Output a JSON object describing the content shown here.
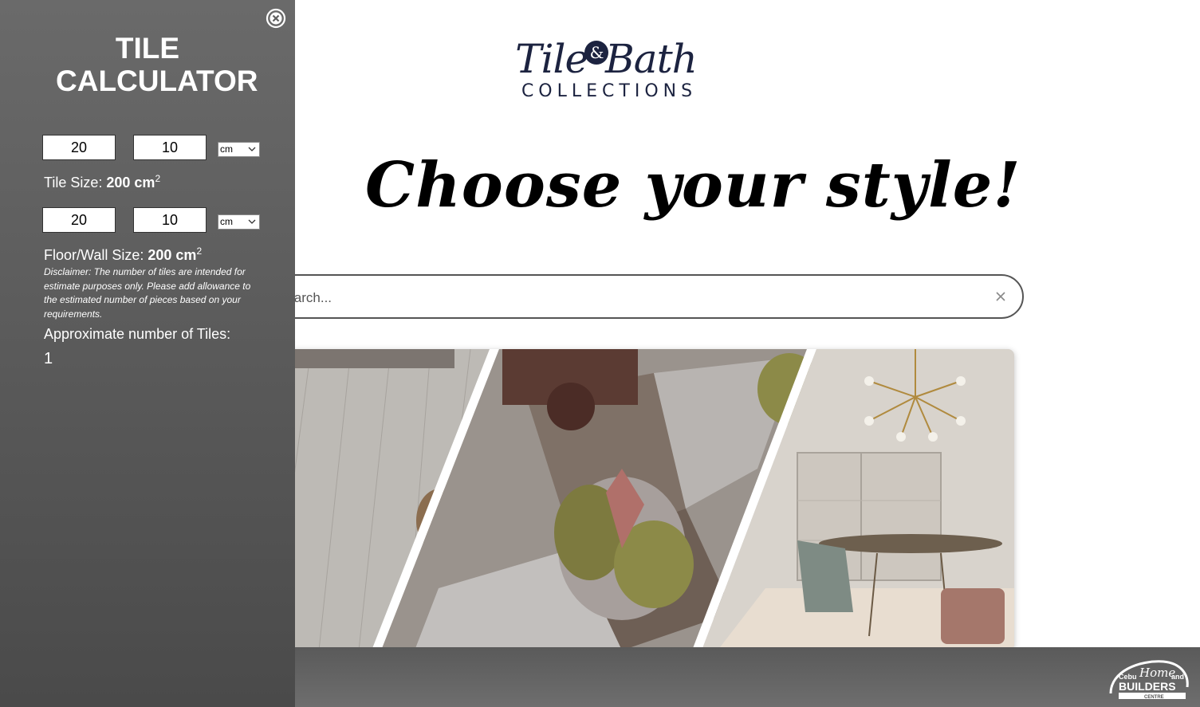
{
  "brand": {
    "logo_script_left": "Tile",
    "logo_amp": "&",
    "logo_script_right": "Bath",
    "logo_sub": "COLLECTIONS"
  },
  "headline": "Choose your style!",
  "search": {
    "placeholder": "Search..."
  },
  "footer": {
    "partner_logo": {
      "line1_left": "Cebu",
      "line1_script": "Home",
      "line1_right": "and",
      "line2": "BUILDERS",
      "line3": "CENTRE"
    }
  },
  "calculator": {
    "title": "TILE CALCULATOR",
    "tile": {
      "width": "20",
      "height": "10",
      "unit": "cm",
      "size_label": "Tile Size:",
      "size_value": "200 cm",
      "size_exp": "2"
    },
    "area": {
      "width": "20",
      "height": "10",
      "unit": "cm",
      "size_label": "Floor/Wall Size:",
      "size_value": "200 cm",
      "size_exp": "2"
    },
    "disclaimer": "Disclaimer: The number of tiles are intended for estimate purposes only. Please add allowance to the estimated number of pieces based on your requirements.",
    "approx_label": "Approximate number of Tiles:",
    "approx_value": "1"
  },
  "colors": {
    "panel_bg": "#5a5a5a",
    "brand_navy": "#1c2340",
    "footer_bg": "#636363"
  },
  "icons": [
    "close-circle-icon",
    "clear-x-icon",
    "chevron-down-icon"
  ]
}
